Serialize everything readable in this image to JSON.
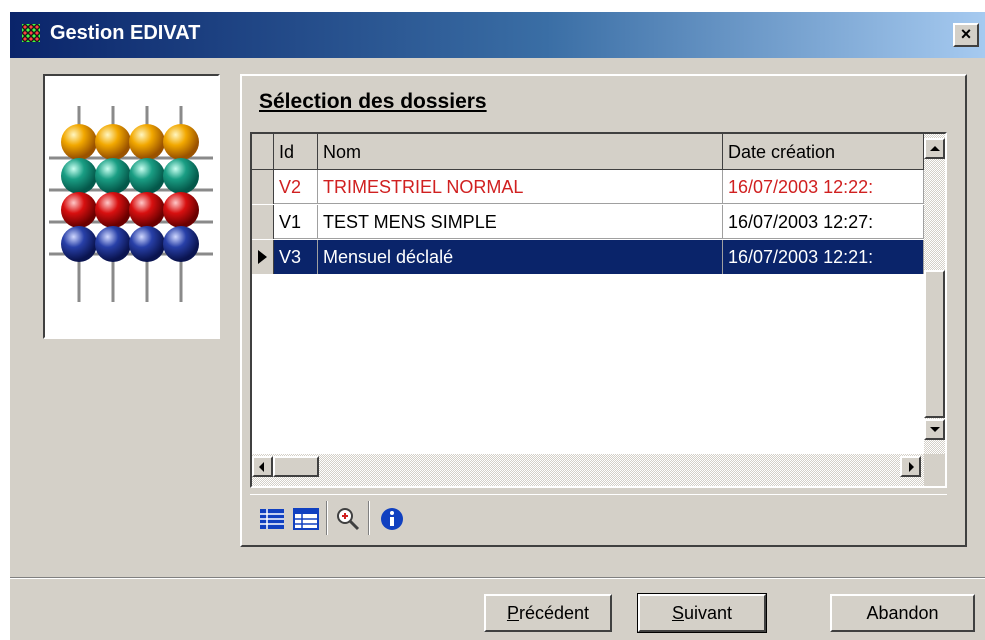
{
  "window": {
    "title": "Gestion EDIVAT",
    "close_label": "×"
  },
  "section": {
    "title": "Sélection des dossiers"
  },
  "grid": {
    "columns": [
      "Id",
      "Nom",
      "Date création"
    ],
    "rows": [
      {
        "id": "V2",
        "nom": "TRIMESTRIEL NORMAL",
        "date": "16/07/2003 12:22:",
        "color": "#d02020"
      },
      {
        "id": "V1",
        "nom": "TEST MENS SIMPLE",
        "date": "16/07/2003 12:27:",
        "color": "#000000"
      },
      {
        "id": "V3",
        "nom": "Mensuel déclalé",
        "date": "16/07/2003 12:21:",
        "selected": true
      }
    ]
  },
  "toolbar": {
    "icons": [
      "grid-view-icon",
      "table-view-icon",
      "zoom-icon",
      "info-icon"
    ]
  },
  "buttons": {
    "prev": {
      "access": "P",
      "rest": "récédent"
    },
    "next": {
      "access": "S",
      "rest": "uivant"
    },
    "cancel": "Abandon"
  },
  "colors": {
    "title_bar": "#0a246a",
    "selection": "#0a246a",
    "highlight_text": "#d02020",
    "face": "#d4d0c8"
  }
}
